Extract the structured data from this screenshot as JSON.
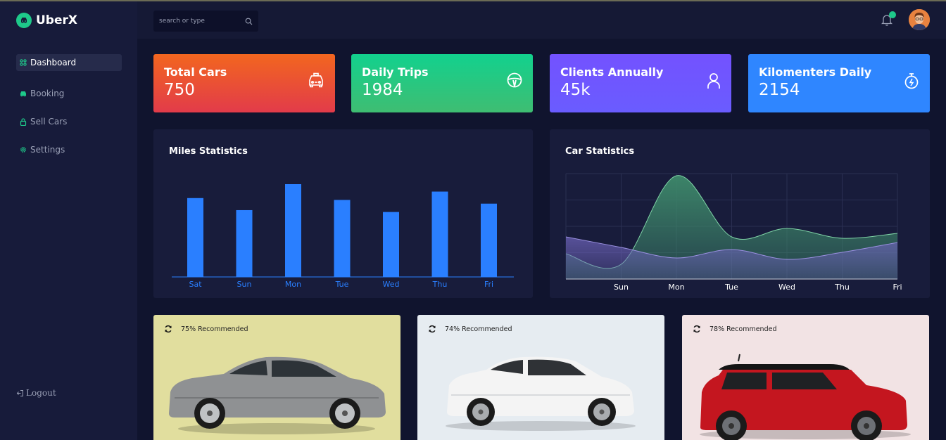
{
  "app": {
    "name": "UberX"
  },
  "sidebar": {
    "items": [
      {
        "label": "Dashboard",
        "icon": "grid-icon",
        "active": true
      },
      {
        "label": "Booking",
        "icon": "car-icon"
      },
      {
        "label": "Sell Cars",
        "icon": "lock-icon"
      },
      {
        "label": "Settings",
        "icon": "gear-icon"
      }
    ],
    "logout_label": "Logout"
  },
  "search": {
    "placeholder": "search or type"
  },
  "stats": [
    {
      "title": "Total Cars",
      "value": "750",
      "color_from": "#f2661f",
      "color_to": "#e23b4a",
      "icon": "taxi-icon"
    },
    {
      "title": "Daily Trips",
      "value": "1984",
      "color_from": "#12d18e",
      "color_to": "#3fbd72",
      "icon": "steering-wheel-icon"
    },
    {
      "title": "Clients Annually",
      "value": "45k",
      "color_from": "#7352ff",
      "color_to": "#6a5cff",
      "icon": "user-icon"
    },
    {
      "title": "Kilomenters Daily",
      "value": "2154",
      "color_from": "#2f86ff",
      "color_to": "#2f86ff",
      "icon": "stopwatch-icon"
    }
  ],
  "miles_chart": {
    "title": "Miles Statistics",
    "chart_data": {
      "type": "bar",
      "categories": [
        "Sat",
        "Sun",
        "Mon",
        "Tue",
        "Wed",
        "Thu",
        "Fri"
      ],
      "values": [
        85,
        72,
        100,
        83,
        70,
        92,
        79
      ],
      "color": "#2a7fff"
    }
  },
  "car_chart": {
    "title": "Car Statistics",
    "chart_data": {
      "type": "area",
      "x": [
        "",
        "Sun",
        "Mon",
        "Tue",
        "Wed",
        "Thu",
        "Fri"
      ],
      "series": [
        {
          "values": [
            36,
            21,
            147,
            60,
            72,
            58,
            65
          ],
          "color": "#3e8a6b"
        },
        {
          "values": [
            60,
            45,
            30,
            42,
            28,
            38,
            52
          ],
          "color": "#6c62b8"
        }
      ],
      "ylim": [
        0,
        150
      ],
      "grid": true
    }
  },
  "cars": [
    {
      "recommended": "75% Recommended",
      "bg": "#e1de9e",
      "body": "#8f9193"
    },
    {
      "recommended": "74% Recommended",
      "bg": "#e6ecf1",
      "body": "#f4f4f4"
    },
    {
      "recommended": "78% Recommended",
      "bg": "#f2e3e4",
      "body": "#c4161f"
    }
  ]
}
